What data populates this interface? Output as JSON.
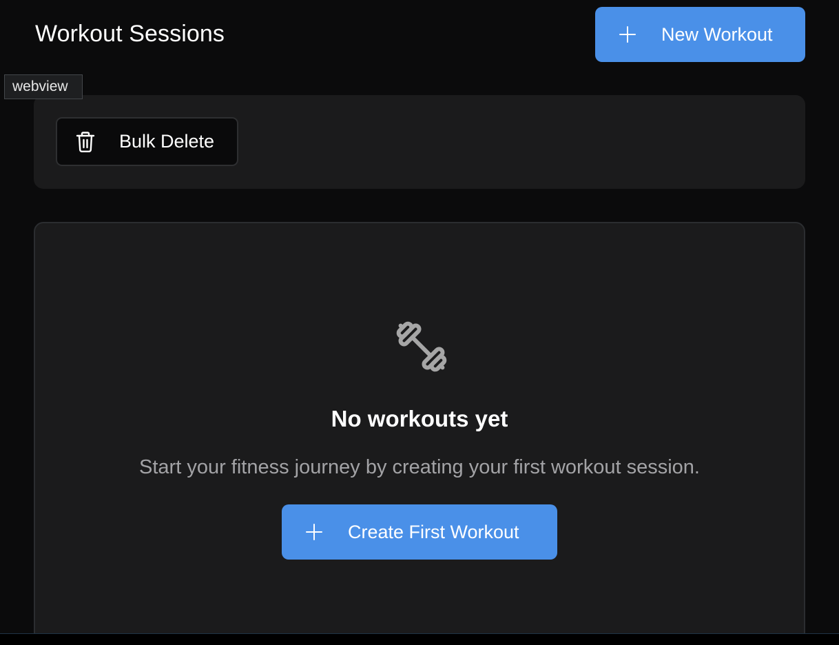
{
  "header": {
    "title": "Workout Sessions",
    "new_workout_label": "New Workout"
  },
  "webview_tag": "webview",
  "toolbar": {
    "bulk_delete_label": "Bulk Delete"
  },
  "empty_state": {
    "icon": "dumbbell-icon",
    "title": "No workouts yet",
    "description": "Start your fitness journey by creating your first workout session.",
    "create_label": "Create First Workout"
  },
  "colors": {
    "background": "#0b0b0c",
    "card": "#1b1b1c",
    "primary": "#4a90e8",
    "muted_text": "#a3a3a6",
    "icon_gray": "#a6a6a6"
  }
}
